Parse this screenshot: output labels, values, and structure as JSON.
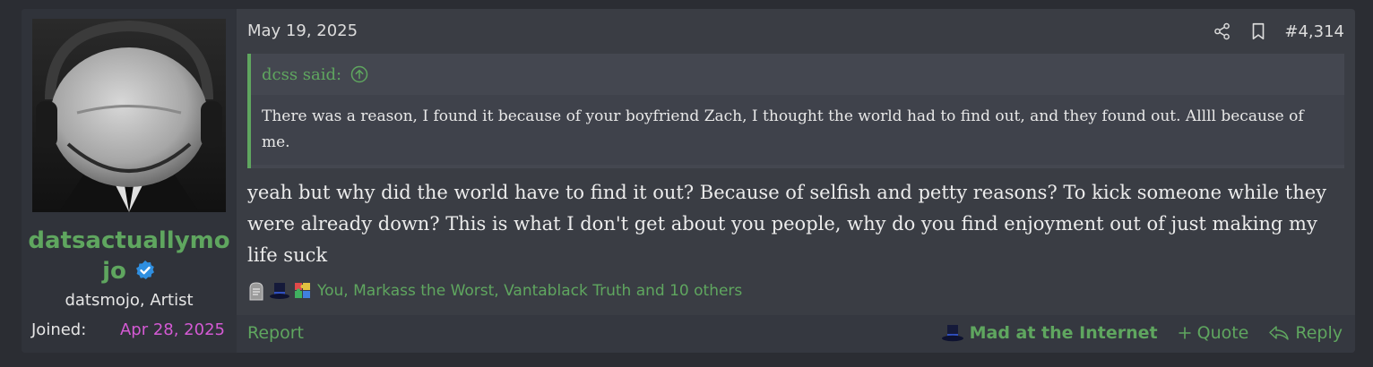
{
  "post": {
    "date": "May 19, 2025",
    "post_number": "#4,314",
    "icons": {
      "share": "share-icon",
      "bookmark": "bookmark-icon"
    }
  },
  "user": {
    "username": "datsactuallymojo",
    "username_line1": "datsactuallymo",
    "username_line2": "jo",
    "title": "datsmojo, Artist",
    "joined_label": "Joined:",
    "joined_date": "Apr 28, 2025",
    "verified_icon": "verified-badge-icon"
  },
  "quote": {
    "author_label": "dcss said:",
    "text": "There was a reason, I found it because of your boyfriend Zach, I thought the world had to find out, and they found out. Allll because of me."
  },
  "message": {
    "text": "yeah but why did the world have to find it out? Because of selfish and petty reasons? To kick someone while they were already down? This is what I don't get about you people, why do you find enjoyment out of just making my life suck"
  },
  "reactions": {
    "icons": [
      "gravestone-icon",
      "top-hat-icon",
      "puzzle-icon"
    ],
    "summary": "You, Markass the Worst, Vantablack Truth and 10 others"
  },
  "footer": {
    "report": "Report",
    "reaction_label": "Mad at the Internet",
    "quote": "Quote",
    "reply": "Reply"
  },
  "colors": {
    "accent_green": "#5fa65f",
    "joined_pink": "#d45ad4",
    "panel": "#3a3d44"
  }
}
